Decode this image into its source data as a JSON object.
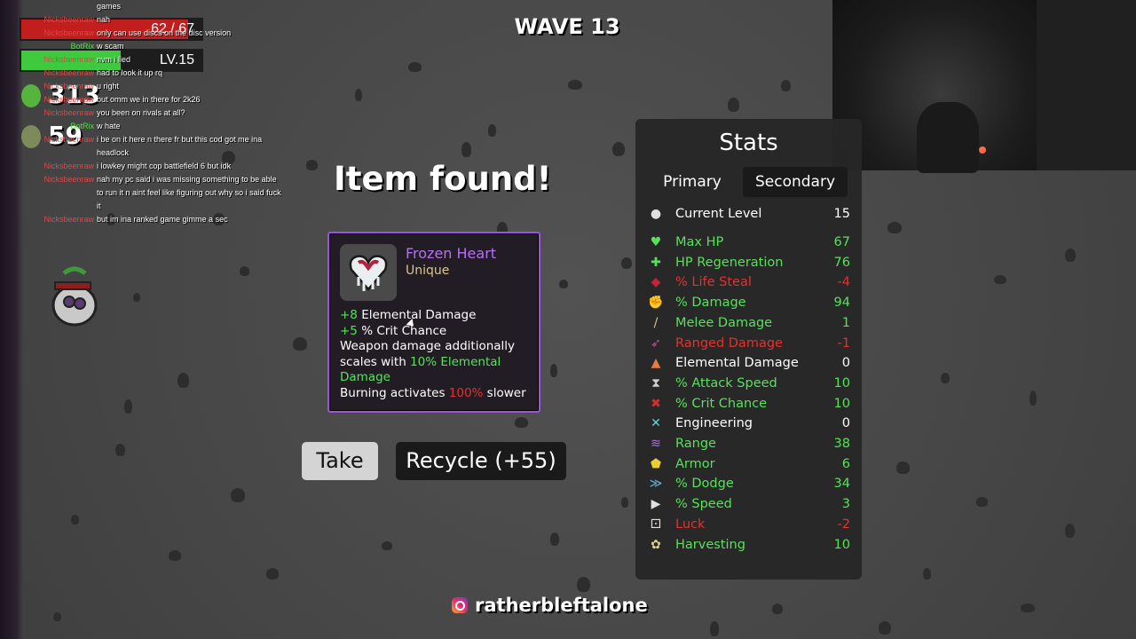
{
  "hud": {
    "hp_text": "62 / 67",
    "hp_fraction": 0.925,
    "level_text": "LV.15",
    "xp_fraction": 0.55,
    "materials": "313",
    "bag": "59"
  },
  "wave": "WAVE 13",
  "chat": [
    {
      "nick": "",
      "msg": "games",
      "color": "#ffffff"
    },
    {
      "nick": "Nicksbeenraw",
      "msg": "nah",
      "color": "#d94a4a"
    },
    {
      "nick": "Nicksbeenraw",
      "msg": "only can use discs on the disc version",
      "color": "#d94a4a"
    },
    {
      "nick": "BotRix",
      "msg": "w scam",
      "color": "#5cd65c"
    },
    {
      "nick": "Nicksbeenraw",
      "msg": "nvm i lied",
      "color": "#d94a4a"
    },
    {
      "nick": "Nicksbeenraw",
      "msg": "had to look it up rq",
      "color": "#d94a4a"
    },
    {
      "nick": "Nicksbeenraw",
      "msg": "u right",
      "color": "#d94a4a"
    },
    {
      "nick": "Nicksbeenraw",
      "msg": "but omm we in there for 2k26",
      "color": "#d94a4a"
    },
    {
      "nick": "Nicksbeenraw",
      "msg": "you been on rivals at all?",
      "color": "#d94a4a"
    },
    {
      "nick": "BotRix",
      "msg": "w hate",
      "color": "#5cd65c"
    },
    {
      "nick": "Nicksbeenraw",
      "msg": "i be on it here n there fr but this cod got me ina headlock",
      "color": "#d94a4a"
    },
    {
      "nick": "Nicksbeenraw",
      "msg": "i lowkey might cop battlefield 6 but idk",
      "color": "#d94a4a"
    },
    {
      "nick": "Nicksbeenraw",
      "msg": "nah my pc said i was missing something to be able to run it n aint feel like figuring out why so i said fuck it",
      "color": "#d94a4a"
    },
    {
      "nick": "Nicksbeenraw",
      "msg": "but im ina ranked game gimme a sec",
      "color": "#d94a4a"
    }
  ],
  "item_found": "Item found!",
  "item": {
    "name": "Frozen Heart",
    "rarity": "Unique",
    "line1_val": "+8",
    "line1_text": " Elemental Damage",
    "line2_val": "+5",
    "line2_text": " % Crit Chance",
    "line3_a": "Weapon damage additionally scales with ",
    "line3_b": "10% Elemental Damage",
    "line4_a": "Burning activates ",
    "line4_b": "100%",
    "line4_c": " slower"
  },
  "buttons": {
    "take": "Take",
    "recycle": "Recycle (+55)"
  },
  "stats": {
    "title": "Stats",
    "tab_primary": "Primary",
    "tab_secondary": "Secondary",
    "rows": [
      {
        "icon": "current-level-icon",
        "label": "Current Level",
        "value": "15",
        "color": "#ffffff"
      },
      {
        "icon": "max-hp-icon",
        "label": "Max HP",
        "value": "67",
        "color": "#57e25a"
      },
      {
        "icon": "hp-regen-icon",
        "label": "HP Regeneration",
        "value": "76",
        "color": "#57e25a"
      },
      {
        "icon": "life-steal-icon",
        "label": "% Life Steal",
        "value": "-4",
        "color": "#e8302d"
      },
      {
        "icon": "damage-icon",
        "label": "% Damage",
        "value": "94",
        "color": "#57e25a"
      },
      {
        "icon": "melee-damage-icon",
        "label": "Melee Damage",
        "value": "1",
        "color": "#57e25a"
      },
      {
        "icon": "ranged-damage-icon",
        "label": "Ranged Damage",
        "value": "-1",
        "color": "#e8302d"
      },
      {
        "icon": "elemental-damage-icon",
        "label": "Elemental Damage",
        "value": "0",
        "color": "#ffffff"
      },
      {
        "icon": "attack-speed-icon",
        "label": "% Attack Speed",
        "value": "10",
        "color": "#57e25a"
      },
      {
        "icon": "crit-chance-icon",
        "label": "% Crit Chance",
        "value": "10",
        "color": "#57e25a"
      },
      {
        "icon": "engineering-icon",
        "label": "Engineering",
        "value": "0",
        "color": "#ffffff"
      },
      {
        "icon": "range-icon",
        "label": "Range",
        "value": "38",
        "color": "#57e25a"
      },
      {
        "icon": "armor-icon",
        "label": "Armor",
        "value": "6",
        "color": "#57e25a"
      },
      {
        "icon": "dodge-icon",
        "label": "% Dodge",
        "value": "34",
        "color": "#57e25a"
      },
      {
        "icon": "speed-icon",
        "label": "% Speed",
        "value": "3",
        "color": "#57e25a"
      },
      {
        "icon": "luck-icon",
        "label": "Luck",
        "value": "-2",
        "color": "#e8302d"
      },
      {
        "icon": "harvesting-icon",
        "label": "Harvesting",
        "value": "10",
        "color": "#57e25a"
      }
    ]
  },
  "social_handle": "ratherbleftalone"
}
